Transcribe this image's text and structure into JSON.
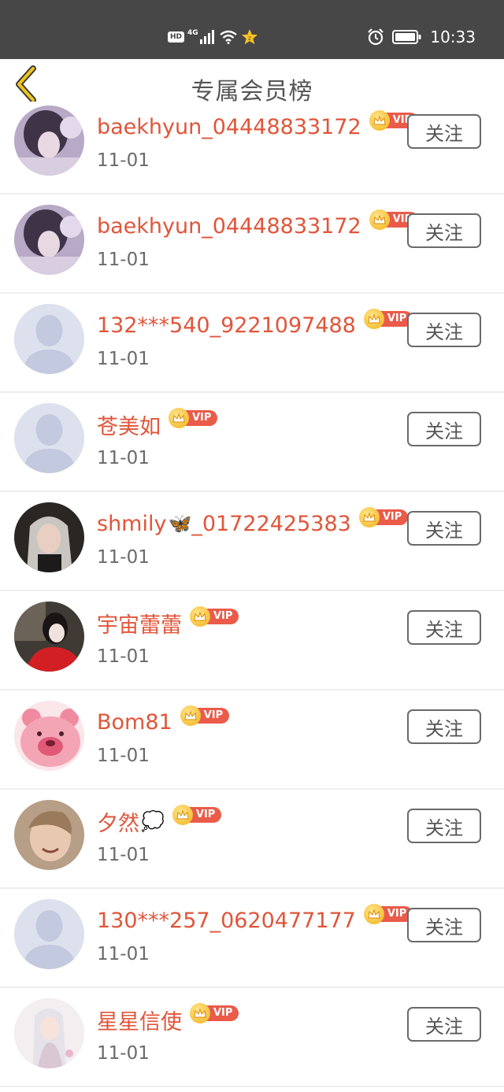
{
  "status_bar": {
    "hd": "HD",
    "network": "4G",
    "time": "10:33"
  },
  "header": {
    "title": "专属会员榜"
  },
  "vip_label": "VIP",
  "members": [
    {
      "name": "baekhyun_04448833172",
      "date": "11-01",
      "follow": "关注",
      "avatar": "photo-girl-lavender"
    },
    {
      "name": "baekhyun_04448833172",
      "date": "11-01",
      "follow": "关注",
      "avatar": "photo-girl-lavender"
    },
    {
      "name": "132***540_9221097488",
      "date": "11-01",
      "follow": "关注",
      "avatar": "default"
    },
    {
      "name": "苍美如",
      "date": "11-01",
      "follow": "关注",
      "avatar": "default"
    },
    {
      "name": "shmily",
      "name_suffix": "_01722425383",
      "emoji": "🦋",
      "date": "11-01",
      "follow": "关注",
      "avatar": "photo-silver-hair"
    },
    {
      "name": "宇宙蕾蕾",
      "date": "11-01",
      "follow": "关注",
      "avatar": "photo-red-coat"
    },
    {
      "name": "Bom81",
      "date": "11-01",
      "follow": "关注",
      "avatar": "pink-bear"
    },
    {
      "name": "夕然",
      "emoji": "💭",
      "date": "11-01",
      "follow": "关注",
      "avatar": "photo-child"
    },
    {
      "name": "130***257_0620477177",
      "date": "11-01",
      "follow": "关注",
      "avatar": "default"
    },
    {
      "name": "星星信使",
      "date": "11-01",
      "follow": "关注",
      "avatar": "photo-fairy"
    }
  ]
}
